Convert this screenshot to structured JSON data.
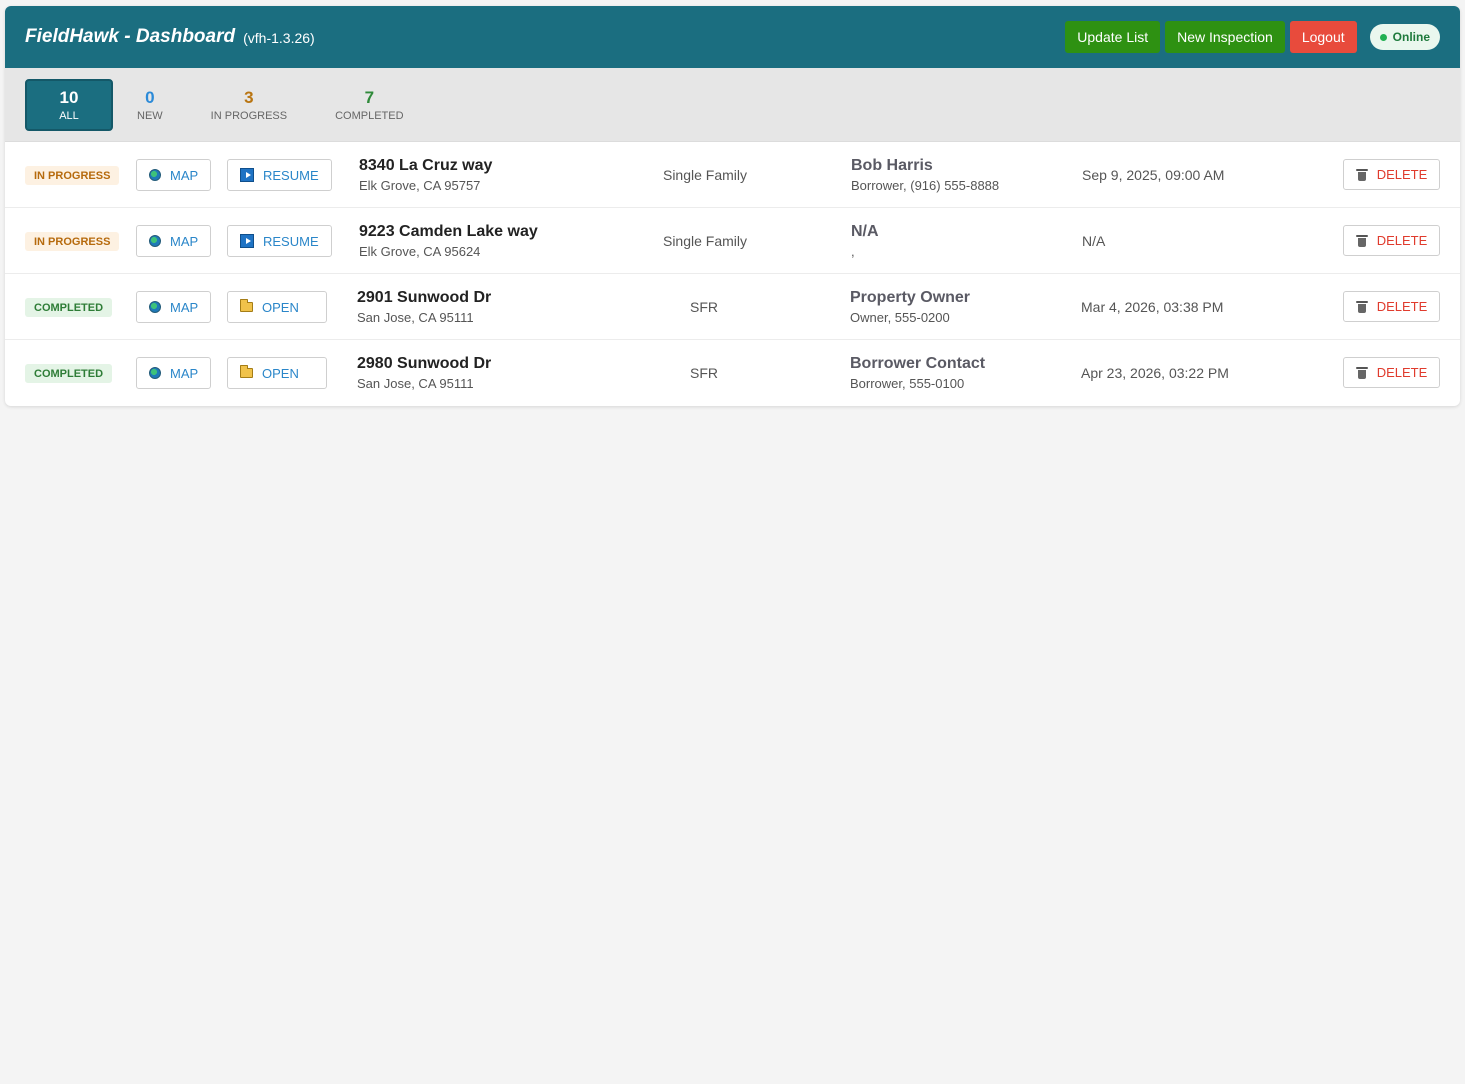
{
  "header": {
    "title": "FieldHawk - Dashboard",
    "version": "(vfh-1.3.26)",
    "update_label": "Update List",
    "new_label": "New Inspection",
    "logout_label": "Logout",
    "status": "Online"
  },
  "filters": [
    {
      "count": "10",
      "label": "ALL"
    },
    {
      "count": "0",
      "label": "NEW"
    },
    {
      "count": "3",
      "label": "IN PROGRESS"
    },
    {
      "count": "7",
      "label": "COMPLETED"
    }
  ],
  "buttons": {
    "map": "MAP",
    "resume": "RESUME",
    "open": "OPEN",
    "delete": "DELETE"
  },
  "rows": [
    {
      "status": "IN PROGRESS",
      "street": "8340 La Cruz way",
      "city": "Elk Grove, CA 95757",
      "type": "Single Family",
      "contact_name": "Bob Harris",
      "contact_info": "Borrower, (916) 555-8888",
      "date": "Sep 9, 2025, 09:00 AM"
    },
    {
      "status": "IN PROGRESS",
      "street": "9223 Camden Lake way",
      "city": "Elk Grove, CA 95624",
      "type": "Single Family",
      "contact_name": "N/A",
      "contact_info": ",",
      "date": "N/A"
    },
    {
      "status": "COMPLETED",
      "street": "2901 Sunwood Dr",
      "city": "San Jose, CA 95111",
      "type": "SFR",
      "contact_name": "Property Owner",
      "contact_info": "Owner, 555-0200",
      "date": "Mar 4, 2026, 03:38 PM"
    },
    {
      "status": "COMPLETED",
      "street": "2980 Sunwood Dr",
      "city": "San Jose, CA 95111",
      "type": "SFR",
      "contact_name": "Borrower Contact",
      "contact_info": "Borrower, 555-0100",
      "date": "Apr 23, 2026, 03:22 PM"
    }
  ]
}
